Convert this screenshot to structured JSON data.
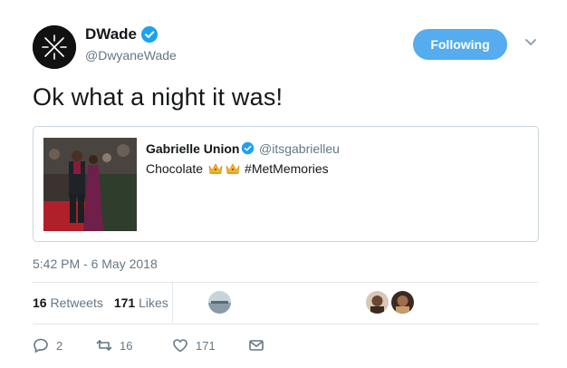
{
  "author": {
    "name": "DWade",
    "handle": "@DwyaneWade",
    "avatar_icon": "x-logo-icon",
    "verified_icon": "verified-badge-icon"
  },
  "follow_button": {
    "label": "Following",
    "color": "#55acee"
  },
  "tweet": {
    "text": "Ok what a night it was!"
  },
  "quoted": {
    "name": "Gabrielle Union",
    "handle": "@itsgabrielleu",
    "text_before": "Chocolate",
    "emoji": "crown-emoji",
    "hashtag": "#MetMemories"
  },
  "timestamp": "5:42 PM - 6 May 2018",
  "stats": {
    "retweets_count": "16",
    "retweets_label": "Retweets",
    "likes_count": "171",
    "likes_label": "Likes"
  },
  "actions": {
    "reply_count": "2",
    "retweet_count": "16",
    "like_count": "171"
  },
  "colors": {
    "accent": "#55acee",
    "muted": "#657786",
    "border": "#e1e8ed"
  }
}
